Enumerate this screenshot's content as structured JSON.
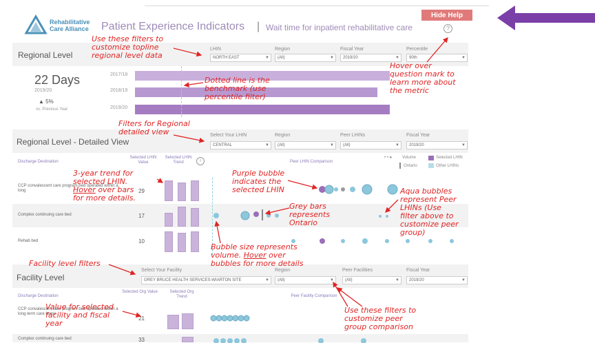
{
  "header": {
    "logo_text_line1": "Rehabilitative",
    "logo_text_line2": "Care Alliance",
    "title": "Patient Experience Indicators",
    "separator": "|",
    "subtitle": "Wait time for inpatient rehabilitative care",
    "help_icon": "?",
    "hide_help_label": "Hide Help"
  },
  "regional": {
    "section_title": "Regional Level",
    "filters": [
      {
        "label": "LHIN",
        "value": "NORTH EAST"
      },
      {
        "label": "Region",
        "value": "(All)"
      },
      {
        "label": "Fiscal Year",
        "value": "2019/20"
      },
      {
        "label": "Percentile",
        "value": "90th"
      }
    ],
    "kpi": {
      "value": "22 Days",
      "year": "2019/20",
      "change": "▲ 5%",
      "vs": "vs. Previous Year"
    },
    "bars": [
      {
        "year": "2017/18",
        "value": 100,
        "shade": "#c9b0dc"
      },
      {
        "year": "2018/19",
        "value": 95,
        "shade": "#b898d0"
      },
      {
        "year": "2019/20",
        "value": 100,
        "shade": "#a57cc2"
      }
    ],
    "benchmark_fraction": 0.0
  },
  "detailed": {
    "section_title": "Regional Level - Detailed View",
    "filters": [
      {
        "label": "Select Your LHIN",
        "value": "CENTRAL"
      },
      {
        "label": "Region",
        "value": "(All)"
      },
      {
        "label": "Peer LHINs",
        "value": "(All)"
      },
      {
        "label": "Fiscal Year",
        "value": "2019/20"
      }
    ],
    "columns": {
      "destination": "Discharge Destination",
      "value": "Selected LHIN Value",
      "trend": "Selected LHIN Trend",
      "comparison": "Peer LHIN Comparison"
    },
    "legend": {
      "volume": "Volume",
      "selected": "Selected LHIN",
      "ontario": "Ontario",
      "other": "Other LHINs"
    },
    "rows": [
      {
        "label": "CCP convalescent care program bed operated within a long",
        "value": "29"
      },
      {
        "label": "Complex continuing care bed",
        "value": "17"
      },
      {
        "label": "Rehab bed",
        "value": "10"
      }
    ]
  },
  "facility": {
    "section_title": "Facility Level",
    "filters": [
      {
        "label": "Select Your Facility",
        "value": "GREY BRUCE HEALTH SERVICES-WIARTON SITE"
      },
      {
        "label": "Region",
        "value": "(All)"
      },
      {
        "label": "Peer Facilities",
        "value": "(All)"
      },
      {
        "label": "Fiscal Year",
        "value": "2019/20"
      }
    ],
    "columns": {
      "destination": "Discharge Destination",
      "value": "Selected Org Value",
      "trend": "Selected Org Trend",
      "comparison": "Peer Facility Comparison"
    },
    "rows": [
      {
        "label": "CCP convalescent care program bed operated within a long-term care home",
        "value": "21"
      },
      {
        "label": "Complex continuing care bed",
        "value": "33"
      }
    ]
  },
  "annotations": {
    "topline_filters": [
      "Use these filters to",
      "customize topline",
      "regional level data"
    ],
    "question_mark": [
      "Hover over",
      "question mark to",
      "learn more about",
      "the metric"
    ],
    "dotted_line": [
      "Dotted line is the",
      "benchmark (use",
      "percentile filter)"
    ],
    "regional_filters": [
      "Filters for Regional",
      "detailed view"
    ],
    "trend": [
      "3-year trend for",
      "selected LHIN.",
      "Hover",
      "over bars",
      "for more details."
    ],
    "purple_bubble": [
      "Purple bubble",
      "indicates the",
      "selected LHIN"
    ],
    "aqua_bubbles": [
      "Aqua bubbles",
      "represent Peer",
      "LHINs (Use",
      "filter above to",
      "customize peer",
      "group)"
    ],
    "grey_bars": [
      "Grey bars",
      "represents",
      "Ontario"
    ],
    "bubble_size": [
      "Bubble size represents",
      "volume.",
      "Hover",
      "over",
      "bubbles for more details"
    ],
    "facility_filters": "Facility level filters",
    "value_selected": [
      "Value for selected",
      "facility and fiscal",
      "year"
    ],
    "peer_filters": [
      "Use these filters to",
      "customize peer",
      "group comparison"
    ]
  },
  "colors": {
    "accent_purple": "#9f8bb8",
    "annotation_red": "#e02424",
    "aqua": "#8cc7dc",
    "selected_purple": "#9b6fb8",
    "hide_help": "#e07a7a",
    "big_arrow": "#7b3fa8"
  },
  "icons": {
    "logo": "triangle-logo-icon",
    "help": "question-circle-icon",
    "arrow": "left-arrow-icon",
    "dropdown": "chevron-down-icon"
  }
}
